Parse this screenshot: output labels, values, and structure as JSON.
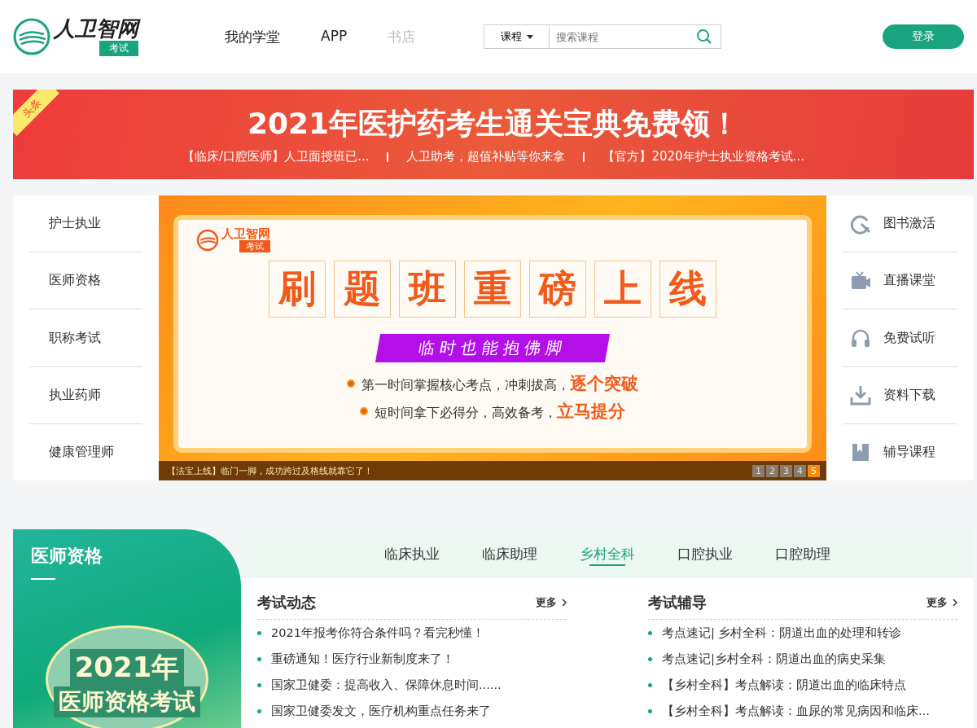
{
  "header": {
    "logo": {
      "name": "人卫智网",
      "tag": "考试"
    },
    "nav": [
      {
        "label": "我的学堂",
        "disabled": false
      },
      {
        "label": "APP",
        "disabled": false
      },
      {
        "label": "书店",
        "disabled": true
      }
    ],
    "search": {
      "category": "课程",
      "placeholder": "搜索课程"
    },
    "login": "登录"
  },
  "headline": {
    "badge": "头条",
    "title": "2021年医护药考生通关宝典免费领！",
    "links": [
      "【临床/口腔医师】人卫面授班已...",
      "人卫助考，超值补贴等你来拿",
      "【官方】2020年护士执业资格考试..."
    ]
  },
  "left_menu": [
    "护士执业",
    "医师资格",
    "职称考试",
    "执业药师",
    "健康管理师"
  ],
  "carousel": {
    "brand": {
      "name": "人卫智网",
      "tag": "考试"
    },
    "headline": "刷题班重磅上线",
    "ribbon": "临时也能抱佛脚",
    "bullets": [
      {
        "text": "第一时间掌握核心考点，冲刺拔高，",
        "highlight": "逐个突破"
      },
      {
        "text": "短时间拿下必得分，高效备考，",
        "highlight": "立马提分"
      }
    ],
    "caption": "【法宝上线】临门一脚，成功跨过及格线就靠它了！",
    "pages": [
      {
        "label": "1",
        "selected": false
      },
      {
        "label": "2",
        "selected": false
      },
      {
        "label": "3",
        "selected": false
      },
      {
        "label": "4",
        "selected": false
      },
      {
        "label": "5",
        "selected": true
      }
    ]
  },
  "right_menu": [
    {
      "label": "图书激活",
      "kind": "activate"
    },
    {
      "label": "直播课堂",
      "kind": "live"
    },
    {
      "label": "免费试听",
      "kind": "listen"
    },
    {
      "label": "资料下载",
      "kind": "download"
    },
    {
      "label": "辅导课程",
      "kind": "course"
    }
  ],
  "section": {
    "title": "医师资格",
    "poster": {
      "lines": [
        "2021年",
        "医师资格考试"
      ]
    },
    "tabs": [
      {
        "label": "临床执业",
        "selected": false
      },
      {
        "label": "临床助理",
        "selected": false
      },
      {
        "label": "乡村全科",
        "selected": true
      },
      {
        "label": "口腔执业",
        "selected": false
      },
      {
        "label": "口腔助理",
        "selected": false
      }
    ],
    "columns": [
      {
        "title": "考试动态",
        "more": "更多",
        "items": [
          "2021年报考你符合条件吗？看完秒懂！",
          "重磅通知！医疗行业新制度来了！",
          "国家卫健委：提高收入、保障休息时间......",
          "国家卫健委发文，医疗机构重点任务来了"
        ]
      },
      {
        "title": "考试辅导",
        "more": "更多",
        "items": [
          "考点速记| 乡村全科：阴道出血的处理和转诊",
          "考点速记|乡村全科：阴道出血的病史采集",
          "【乡村全科】考点解读：阴道出血的临床特点",
          "【乡村全科】考点解读：血尿的常见病因和临床..."
        ]
      }
    ]
  }
}
